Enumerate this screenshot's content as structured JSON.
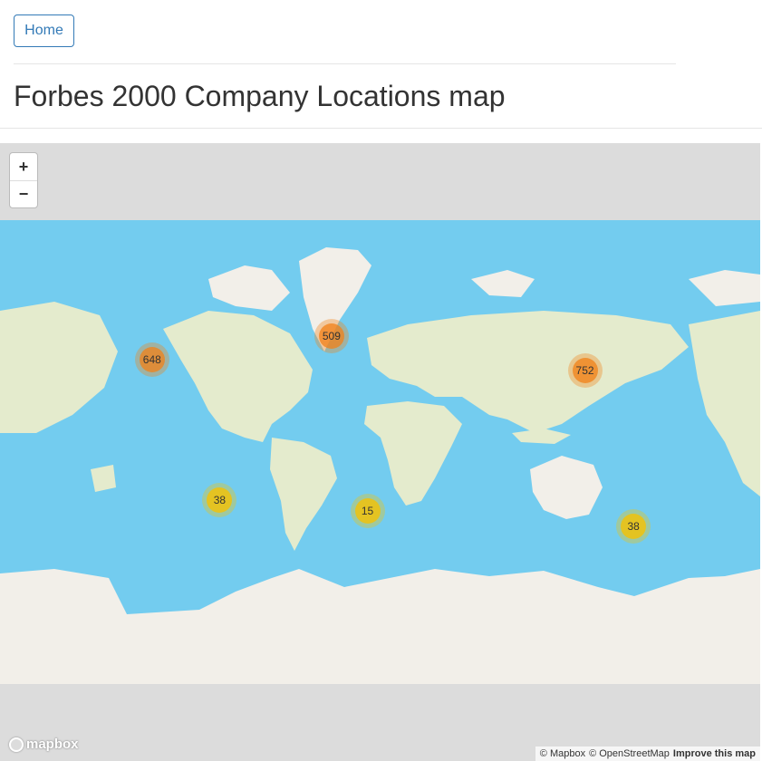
{
  "nav": {
    "home_label": "Home"
  },
  "page": {
    "title": "Forbes 2000 Company Locations map"
  },
  "map": {
    "zoom_in_label": "+",
    "zoom_out_label": "−",
    "clusters": [
      {
        "label": "648",
        "level": "orange",
        "lon": -78,
        "lat": 40
      },
      {
        "label": "509",
        "level": "orange",
        "lon": 7,
        "lat": 48
      },
      {
        "label": "752",
        "level": "orange",
        "lon": 127,
        "lat": 36
      },
      {
        "label": "38",
        "level": "yellow",
        "lon": -46,
        "lat": -22
      },
      {
        "label": "15",
        "level": "yellow",
        "lon": 24,
        "lat": -27
      },
      {
        "label": "38",
        "level": "yellow",
        "lon": 150,
        "lat": -33
      }
    ],
    "logo_text": "mapbox",
    "attribution": {
      "mapbox": "© Mapbox",
      "osm": "© OpenStreetMap",
      "improve": "Improve this map"
    },
    "colors": {
      "ocean": "#73ccef",
      "land": "#e4ebcd",
      "ice": "#f2efe9",
      "background": "#dcdcdc"
    }
  }
}
